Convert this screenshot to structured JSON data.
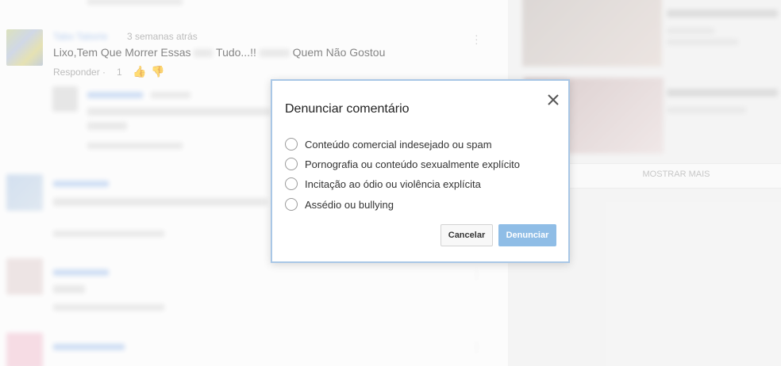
{
  "background": {
    "comment1": {
      "author_blurred": "Tabo Taborie",
      "timestamp": "3 semanas atrás",
      "text_part1": "Lixo,Tem Que Morrer Essas",
      "text_part2": "Tudo...!!",
      "text_part3": "Quem Não Gostou",
      "reply_label": "Responder",
      "like_count": "1"
    },
    "show_more_label": "MOSTRAR MAIS"
  },
  "dialog": {
    "title": "Denunciar comentário",
    "options": [
      {
        "label": "Conteúdo comercial indesejado ou spam"
      },
      {
        "label": "Pornografia ou conteúdo sexualmente explícito"
      },
      {
        "label": "Incitação ao ódio ou violência explícita"
      },
      {
        "label": "Assédio ou bullying"
      }
    ],
    "cancel_label": "Cancelar",
    "submit_label": "Denunciar"
  },
  "colors": {
    "accent": "#8fbde6",
    "dialog_border": "#a9c7e6"
  }
}
